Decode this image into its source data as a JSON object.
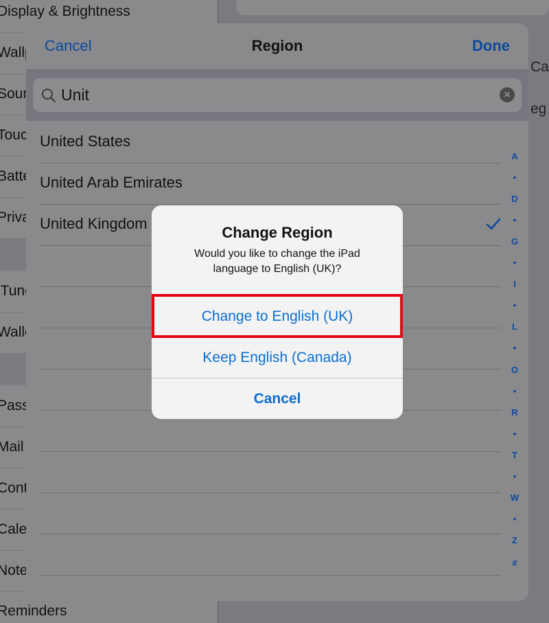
{
  "background": {
    "left_rows": [
      {
        "label": "Display & Brightness"
      },
      {
        "label": "Wallpaper"
      },
      {
        "label": "Sounds & Sound"
      },
      {
        "label": "Touch ID"
      },
      {
        "label": "Battery"
      },
      {
        "label": "Privacy"
      },
      {
        "label": "iTunes"
      },
      {
        "label": "Wallet & Apple Pay"
      },
      {
        "label": "Passwords"
      },
      {
        "label": "Mail"
      },
      {
        "label": "Contacts"
      },
      {
        "label": "Calendar"
      },
      {
        "label": "Notes"
      },
      {
        "label": "Reminders"
      }
    ],
    "right_texts": [
      "Ca",
      "eg"
    ]
  },
  "sheet": {
    "cancel_label": "Cancel",
    "title": "Region",
    "done_label": "Done",
    "search": {
      "value": "Unit",
      "placeholder": "Search"
    },
    "rows": [
      {
        "label": "United States",
        "selected": false
      },
      {
        "label": "United Arab Emirates",
        "selected": false
      },
      {
        "label": "United Kingdom",
        "selected": true
      }
    ],
    "index": [
      "A",
      "•",
      "D",
      "•",
      "G",
      "•",
      "I",
      "•",
      "L",
      "•",
      "O",
      "•",
      "R",
      "•",
      "T",
      "•",
      "W",
      "•",
      "Z",
      "#"
    ]
  },
  "alert": {
    "title": "Change Region",
    "message": "Would you like to change the iPad language to English (UK)?",
    "buttons": {
      "change": "Change to English (UK)",
      "keep": "Keep English (Canada)",
      "cancel": "Cancel"
    }
  },
  "colors": {
    "accent": "#0a6ed1",
    "highlight": "#e30613"
  }
}
